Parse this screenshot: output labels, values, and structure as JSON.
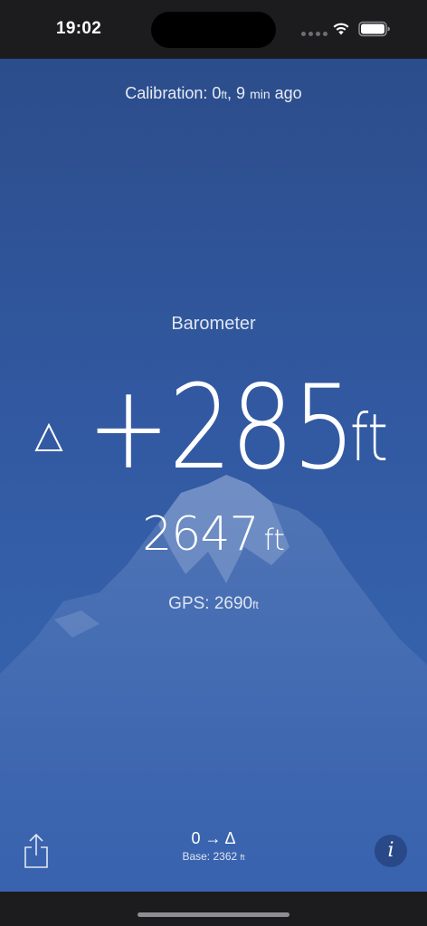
{
  "status_bar": {
    "time": "19:02"
  },
  "calibration": {
    "prefix": "Calibration: ",
    "value": "0",
    "unit": "ft",
    "separator": ", ",
    "ago_value": "9",
    "ago_unit": "min",
    "ago_suffix": " ago"
  },
  "mode_label": "Barometer",
  "delta": {
    "symbol": "Δ",
    "value": "+285",
    "unit": "ft"
  },
  "altitude": {
    "value": "2647",
    "unit": "ft"
  },
  "gps": {
    "prefix": "GPS: ",
    "value": "2690",
    "unit": "ft"
  },
  "toolbar": {
    "share_icon": "share-icon",
    "mode_toggle_label": "0 → Δ",
    "base_prefix": "Base: ",
    "base_value": "2362",
    "base_unit": "ft",
    "info_label": "i"
  },
  "colors": {
    "background": "#3158a0",
    "status_bar": "#1c1c1e",
    "text": "#ffffff"
  }
}
